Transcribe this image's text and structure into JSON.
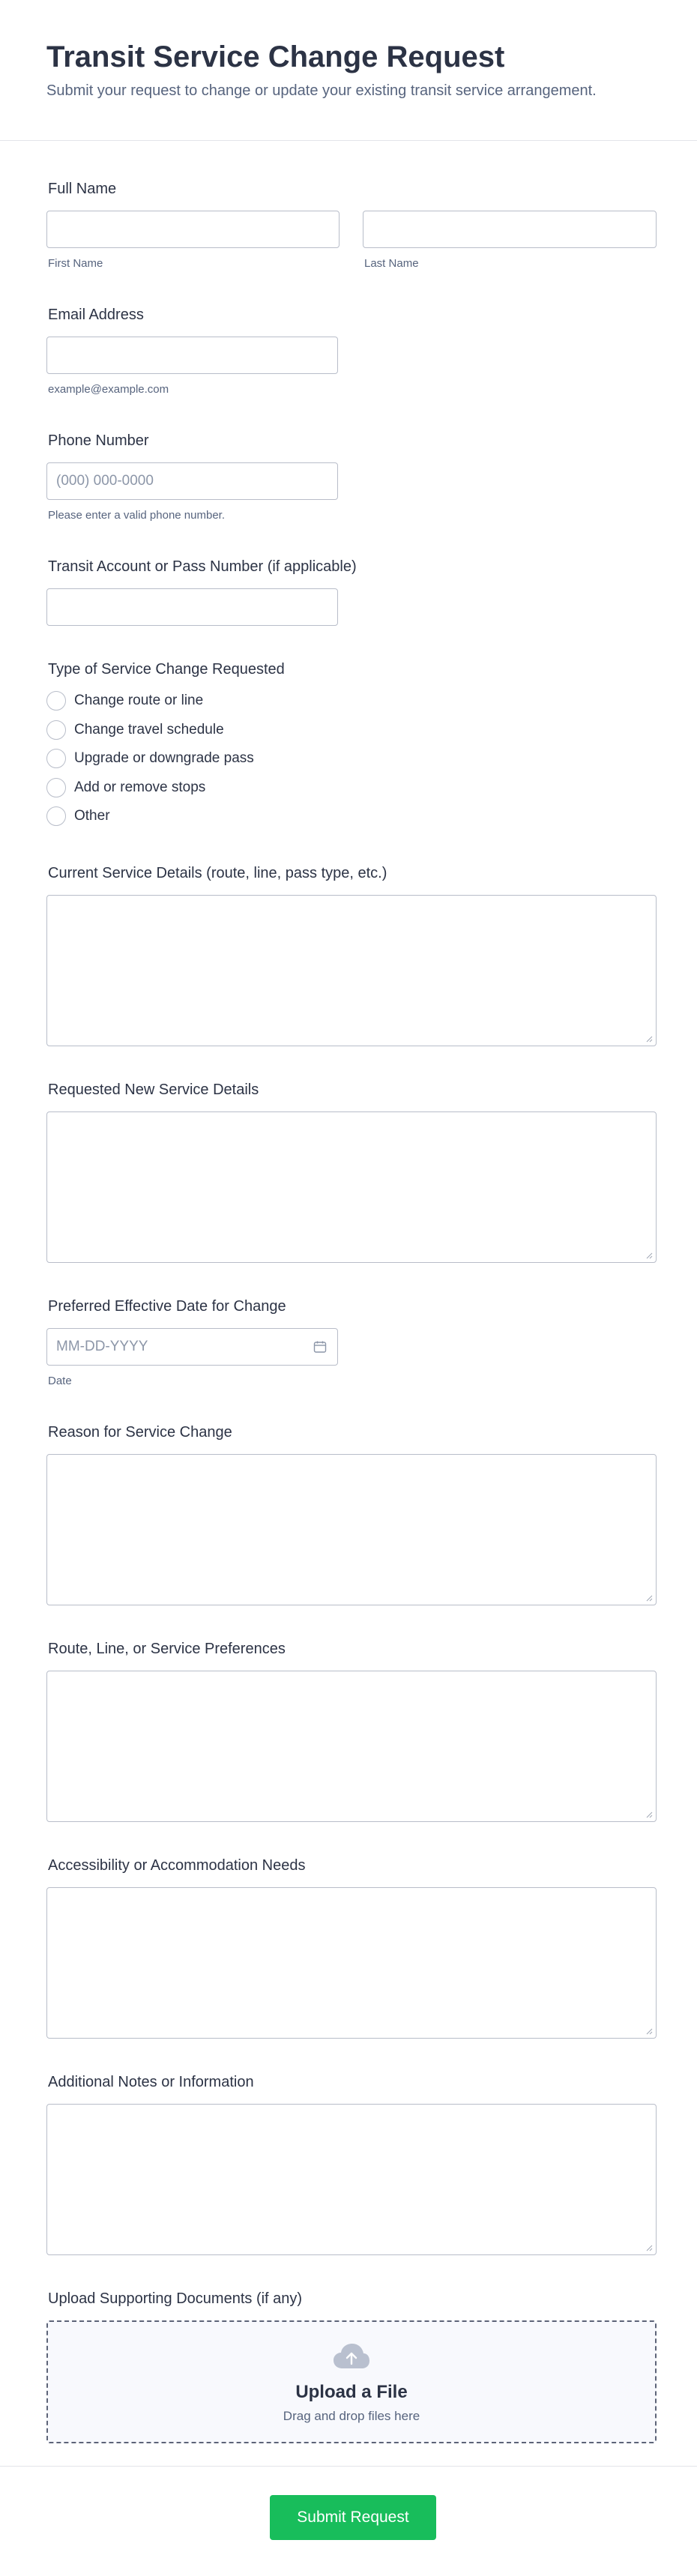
{
  "form": {
    "title": "Transit Service Change Request",
    "subtitle": "Submit your request to change or update your existing transit service arrangement."
  },
  "full_name": {
    "label": "Full Name",
    "first_sublabel": "First Name",
    "last_sublabel": "Last Name"
  },
  "email": {
    "label": "Email Address",
    "sublabel": "example@example.com"
  },
  "phone": {
    "label": "Phone Number",
    "placeholder": "(000) 000-0000",
    "sublabel": "Please enter a valid phone number."
  },
  "account": {
    "label": "Transit Account or Pass Number (if applicable)"
  },
  "change_type": {
    "label": "Type of Service Change Requested",
    "options": [
      "Change route or line",
      "Change travel schedule",
      "Upgrade or downgrade pass",
      "Add or remove stops",
      "Other"
    ]
  },
  "current_details": {
    "label": "Current Service Details (route, line, pass type, etc.)"
  },
  "new_details": {
    "label": "Requested New Service Details"
  },
  "effective_date": {
    "label": "Preferred Effective Date for Change",
    "placeholder": "MM-DD-YYYY",
    "sublabel": "Date"
  },
  "reason": {
    "label": "Reason for Service Change"
  },
  "preferences": {
    "label": "Route, Line, or Service Preferences"
  },
  "accessibility": {
    "label": "Accessibility or Accommodation Needs"
  },
  "notes": {
    "label": "Additional Notes or Information"
  },
  "upload": {
    "label": "Upload Supporting Documents (if any)",
    "title": "Upload a File",
    "hint": "Drag and drop files here"
  },
  "submit": {
    "label": "Submit Request"
  },
  "colors": {
    "accent": "#18bd5b",
    "text": "#2c3345",
    "muted": "#57647e",
    "border": "#b8bdc9"
  },
  "icons": [
    "calendar-icon",
    "upload-cloud-icon",
    "resize-handle-icon"
  ]
}
